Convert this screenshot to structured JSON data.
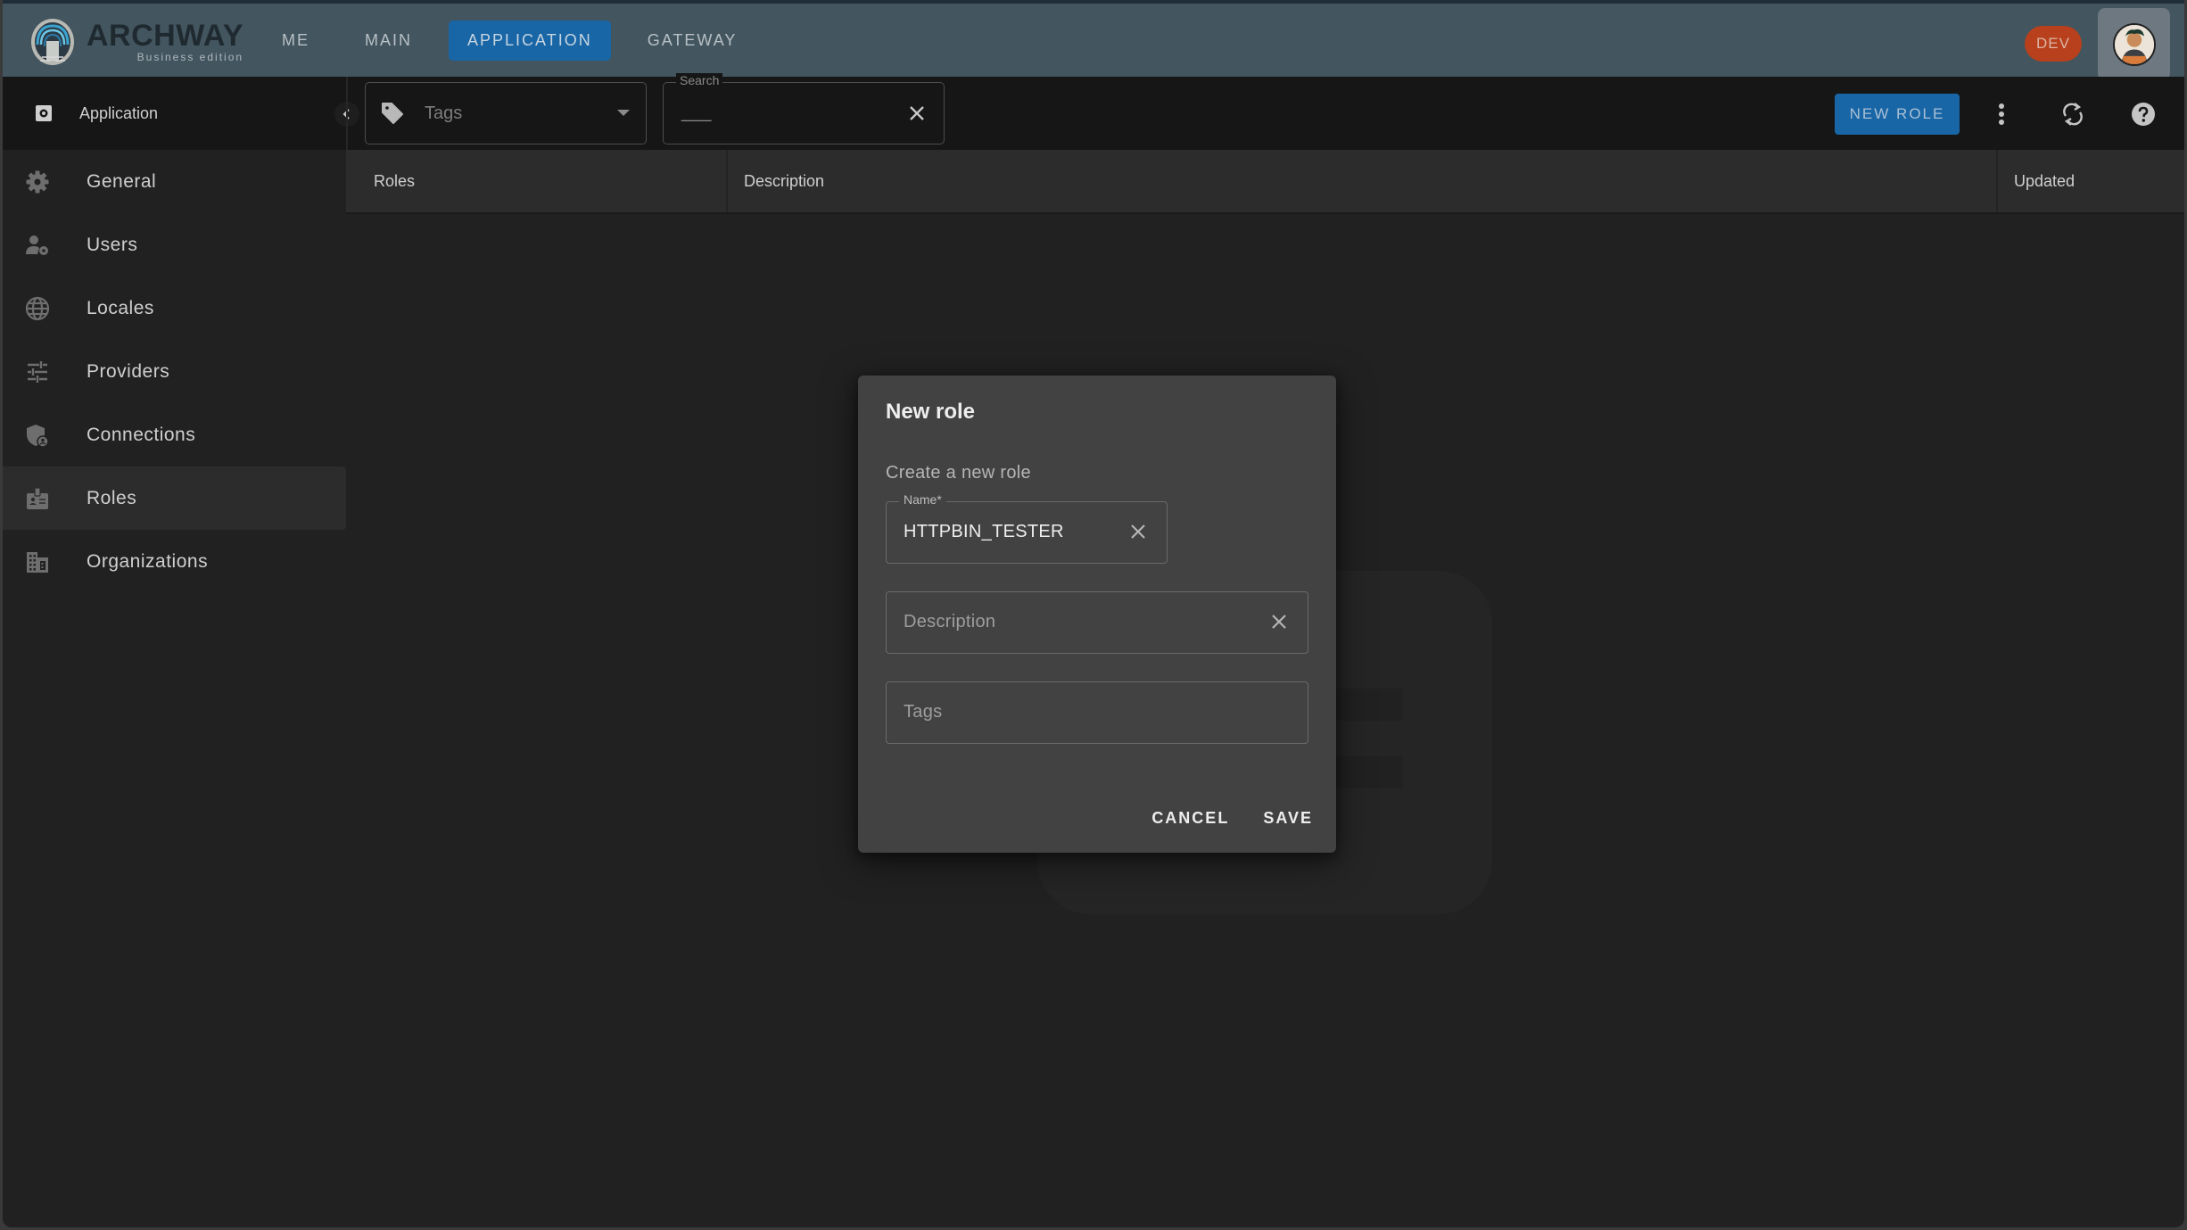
{
  "app": {
    "brand_name": "ARCHWAY",
    "brand_subtitle": "Business edition",
    "environment_badge": "DEV"
  },
  "nav": {
    "tabs": [
      {
        "label": "ME",
        "active": false
      },
      {
        "label": "MAIN",
        "active": false
      },
      {
        "label": "APPLICATION",
        "active": true
      },
      {
        "label": "GATEWAY",
        "active": false
      }
    ]
  },
  "toolbar": {
    "section_title": "Application",
    "tags_filter_placeholder": "Tags",
    "search_label": "Search",
    "search_value": "___",
    "new_role_label": "NEW ROLE",
    "icons": [
      "more-vert-icon",
      "refresh-icon",
      "help-icon"
    ]
  },
  "sidebar": {
    "items": [
      {
        "label": "General",
        "icon": "gear-icon",
        "active": false
      },
      {
        "label": "Users",
        "icon": "user-settings-icon",
        "active": false
      },
      {
        "label": "Locales",
        "icon": "globe-icon",
        "active": false
      },
      {
        "label": "Providers",
        "icon": "sliders-icon",
        "active": false
      },
      {
        "label": "Connections",
        "icon": "shield-user-icon",
        "active": false
      },
      {
        "label": "Roles",
        "icon": "badge-icon",
        "active": true
      },
      {
        "label": "Organizations",
        "icon": "building-icon",
        "active": false
      }
    ]
  },
  "table": {
    "columns": [
      "Roles",
      "Description",
      "Updated"
    ],
    "rows": []
  },
  "dialog": {
    "title": "New role",
    "subtitle": "Create a new role",
    "name_label": "Name*",
    "name_value": "HTTPBIN_TESTER",
    "description_placeholder": "Description",
    "tags_placeholder": "Tags",
    "cancel_label": "CANCEL",
    "save_label": "SAVE"
  },
  "colors": {
    "accent": "#1966a7",
    "topbar": "#43555f",
    "env_badge": "#b8401c",
    "background": "#212121",
    "dialog": "#424242"
  }
}
